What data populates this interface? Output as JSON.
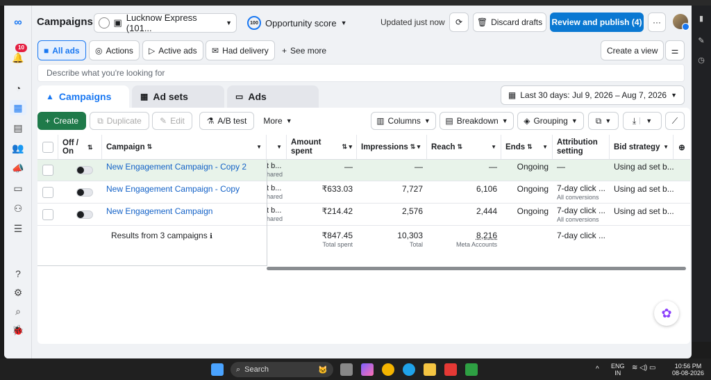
{
  "header": {
    "title": "Campaigns",
    "account_name": "Lucknow Express (101...",
    "opportunity_score_value": "100",
    "opportunity_label": "Opportunity score",
    "updated_text": "Updated just now",
    "discard_label": "Discard drafts",
    "publish_label": "Review and publish (4)",
    "more_label": "···"
  },
  "nav": {
    "notification_count": "10"
  },
  "filters": {
    "items": [
      {
        "label": "All ads"
      },
      {
        "label": "Actions"
      },
      {
        "label": "Active ads"
      },
      {
        "label": "Had delivery"
      },
      {
        "label": "See more"
      }
    ],
    "create_view_label": "Create a view"
  },
  "search": {
    "placeholder": "Describe what you're looking for"
  },
  "tabs": [
    {
      "label": "Campaigns"
    },
    {
      "label": "Ad sets"
    },
    {
      "label": "Ads"
    }
  ],
  "date_range": "Last 30 days: Jul 9, 2026 – Aug 7, 2026",
  "toolbar": {
    "create": "Create",
    "duplicate": "Duplicate",
    "edit": "Edit",
    "ab_test": "A/B test",
    "more": "More",
    "columns": "Columns",
    "breakdown": "Breakdown",
    "grouping": "Grouping"
  },
  "table": {
    "headers": {
      "off_on": "Off / On",
      "campaign": "Campaign",
      "amount_spent": "Amount spent",
      "impressions": "Impressions",
      "reach": "Reach",
      "ends": "Ends",
      "attribution": "Attribution setting",
      "bid_strategy": "Bid strategy"
    },
    "rows": [
      {
        "name": "New Engagement Campaign - Copy 2",
        "col_b": "t b...",
        "col_b_sub": "hared",
        "amount": "—",
        "impressions": "—",
        "reach": "—",
        "ends": "Ongoing",
        "attribution": "—",
        "attribution_sub": "",
        "bid": "Using ad set b..."
      },
      {
        "name": "New Engagement Campaign - Copy",
        "col_b": "t b...",
        "col_b_sub": "hared",
        "amount": "₹633.03",
        "impressions": "7,727",
        "reach": "6,106",
        "ends": "Ongoing",
        "attribution": "7-day click ...",
        "attribution_sub": "All conversions",
        "bid": "Using ad set b..."
      },
      {
        "name": "New Engagement Campaign",
        "col_b": "t b...",
        "col_b_sub": "hared",
        "amount": "₹214.42",
        "impressions": "2,576",
        "reach": "2,444",
        "ends": "Ongoing",
        "attribution": "7-day click ...",
        "attribution_sub": "All conversions",
        "bid": "Using ad set b..."
      }
    ],
    "summary": {
      "label": "Results from 3 campaigns",
      "amount": "₹847.45",
      "amount_sub": "Total spent",
      "impressions": "10,303",
      "impressions_sub": "Total",
      "reach": "8,216",
      "reach_sub": "Meta Accounts",
      "attribution": "7-day click ..."
    }
  },
  "taskbar": {
    "search_label": "Search",
    "lang_top": "ENG",
    "lang_bottom": "IN",
    "time": "10:56 PM",
    "date": "08-08-2026"
  }
}
